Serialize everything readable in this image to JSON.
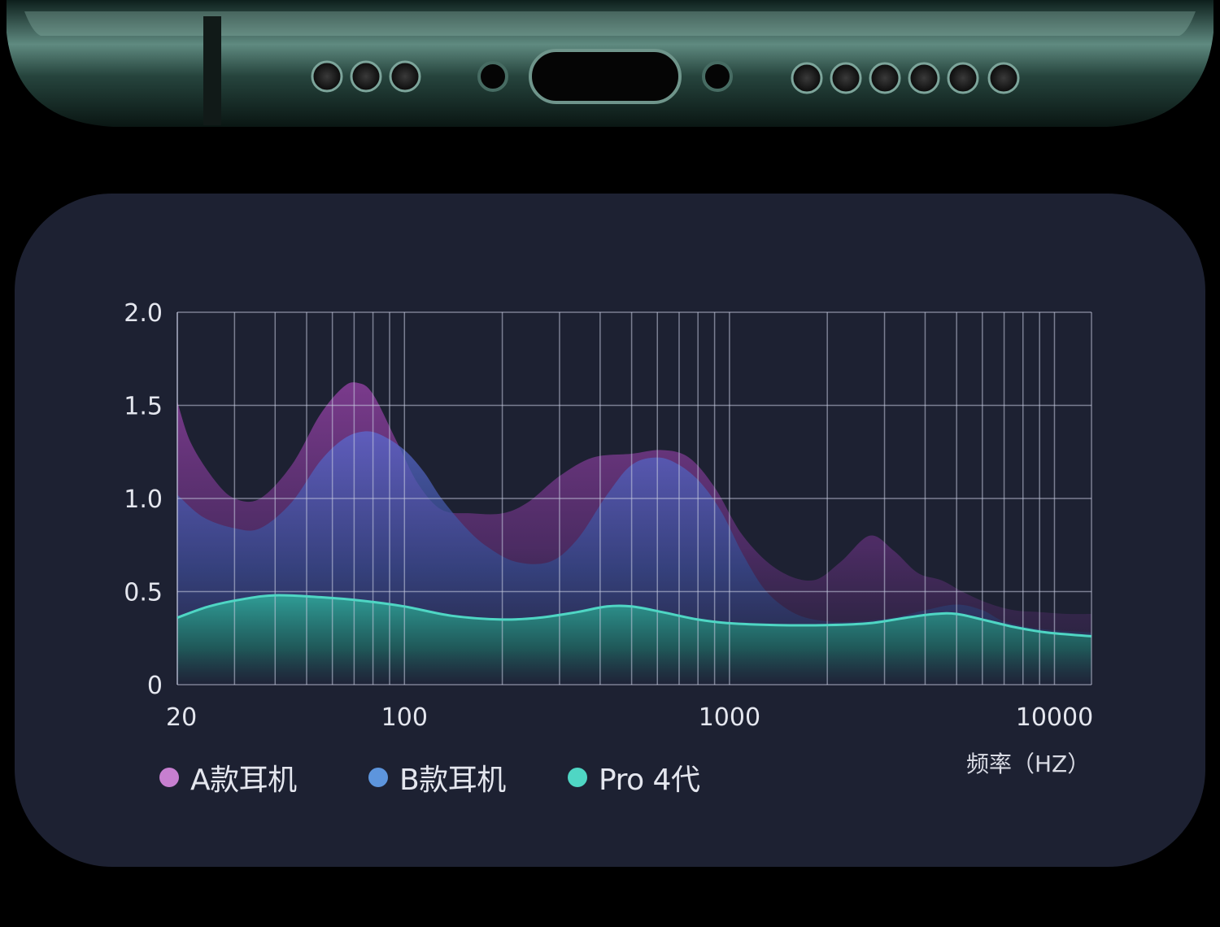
{
  "chart_data": {
    "type": "area",
    "x_scale": "log",
    "xlim": [
      20,
      13000
    ],
    "ylim": [
      0,
      2.0
    ],
    "xticks": [
      "20",
      "100",
      "1000",
      "10000"
    ],
    "yticks": [
      "2.0",
      "1.5",
      "1.0",
      "0.5",
      "0"
    ],
    "xlabel": "频率（HZ）",
    "grid": true,
    "legend_position": "bottom-left",
    "series": [
      {
        "name": "A款耳机",
        "color": "#c77fd0",
        "x": [
          20,
          22,
          26,
          30,
          36,
          45,
          55,
          65,
          72,
          80,
          95,
          110,
          130,
          160,
          200,
          240,
          300,
          380,
          500,
          620,
          750,
          900,
          1100,
          1400,
          1800,
          2200,
          2700,
          3200,
          3800,
          4500,
          5200,
          6200,
          7500,
          9000,
          11000,
          13000
        ],
        "values": [
          1.52,
          1.3,
          1.1,
          1.0,
          1.0,
          1.18,
          1.45,
          1.6,
          1.62,
          1.56,
          1.3,
          1.08,
          0.94,
          0.92,
          0.92,
          0.98,
          1.12,
          1.22,
          1.24,
          1.26,
          1.22,
          1.06,
          0.8,
          0.62,
          0.56,
          0.66,
          0.8,
          0.72,
          0.6,
          0.56,
          0.5,
          0.44,
          0.4,
          0.39,
          0.38,
          0.38
        ]
      },
      {
        "name": "B款耳机",
        "color": "#5d95dd",
        "x": [
          20,
          24,
          30,
          36,
          45,
          55,
          65,
          75,
          85,
          100,
          115,
          130,
          155,
          180,
          220,
          280,
          340,
          420,
          500,
          600,
          700,
          820,
          950,
          1100,
          1300,
          1600,
          2000,
          2500,
          3200,
          4000,
          5000,
          6000,
          7000,
          9000,
          13000
        ],
        "values": [
          1.02,
          0.9,
          0.84,
          0.84,
          0.98,
          1.2,
          1.32,
          1.36,
          1.34,
          1.26,
          1.14,
          1.0,
          0.84,
          0.74,
          0.66,
          0.66,
          0.78,
          1.02,
          1.18,
          1.22,
          1.18,
          1.08,
          0.92,
          0.7,
          0.5,
          0.38,
          0.34,
          0.34,
          0.36,
          0.4,
          0.43,
          0.4,
          0.34,
          0.3,
          0.28
        ]
      },
      {
        "name": "Pro 4代",
        "color": "#4fd6c4",
        "x": [
          20,
          25,
          32,
          40,
          55,
          75,
          100,
          140,
          200,
          260,
          340,
          420,
          500,
          620,
          800,
          1000,
          1400,
          2000,
          2700,
          3500,
          4300,
          5000,
          6000,
          7500,
          9500,
          13000
        ],
        "values": [
          0.36,
          0.42,
          0.46,
          0.48,
          0.47,
          0.45,
          0.42,
          0.37,
          0.35,
          0.36,
          0.39,
          0.42,
          0.42,
          0.39,
          0.35,
          0.33,
          0.32,
          0.32,
          0.33,
          0.36,
          0.38,
          0.38,
          0.35,
          0.31,
          0.28,
          0.26
        ]
      }
    ]
  }
}
